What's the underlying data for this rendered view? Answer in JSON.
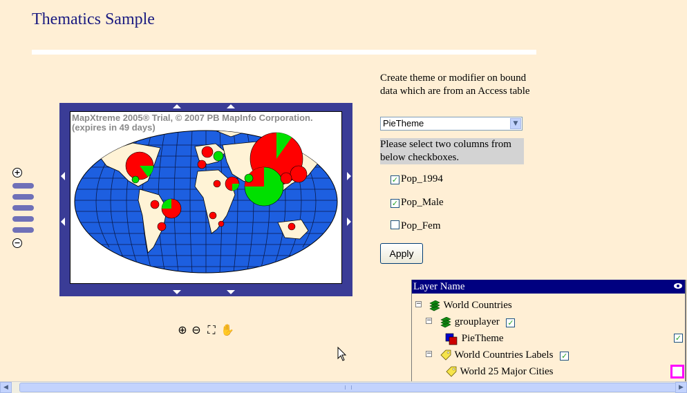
{
  "page": {
    "title": "Thematics Sample"
  },
  "map": {
    "watermark_line1": "MapXtreme 2005® Trial, © 2007 PB MapInfo Corporation.",
    "watermark_line2": "(expires in 49 days)",
    "colors": {
      "ocean": "#1d5fe0",
      "land": "#fff3d6",
      "pie_a": "#ff0000",
      "pie_b": "#00e000",
      "frame": "#3a3c96"
    }
  },
  "zoombar": {
    "zoom_in": "+",
    "zoom_out": "−"
  },
  "panel": {
    "prompt": "Create theme or modifier on bound data which are from an Access table",
    "select_value": "PieTheme",
    "instruction": "Please select two columns from below checkboxes.",
    "checkboxes": [
      {
        "label": "Pop_1994",
        "checked": true
      },
      {
        "label": "Pop_Male",
        "checked": true
      },
      {
        "label": "Pop_Fem",
        "checked": false
      }
    ],
    "apply_label": "Apply"
  },
  "layers": {
    "header": "Layer Name",
    "items": [
      {
        "label": "World Countries"
      },
      {
        "label": "grouplayer",
        "checked": true
      },
      {
        "label": "PieTheme",
        "checked": true
      },
      {
        "label": "World Countries Labels",
        "checked": true
      },
      {
        "label": "World 25 Major Cities"
      }
    ]
  }
}
